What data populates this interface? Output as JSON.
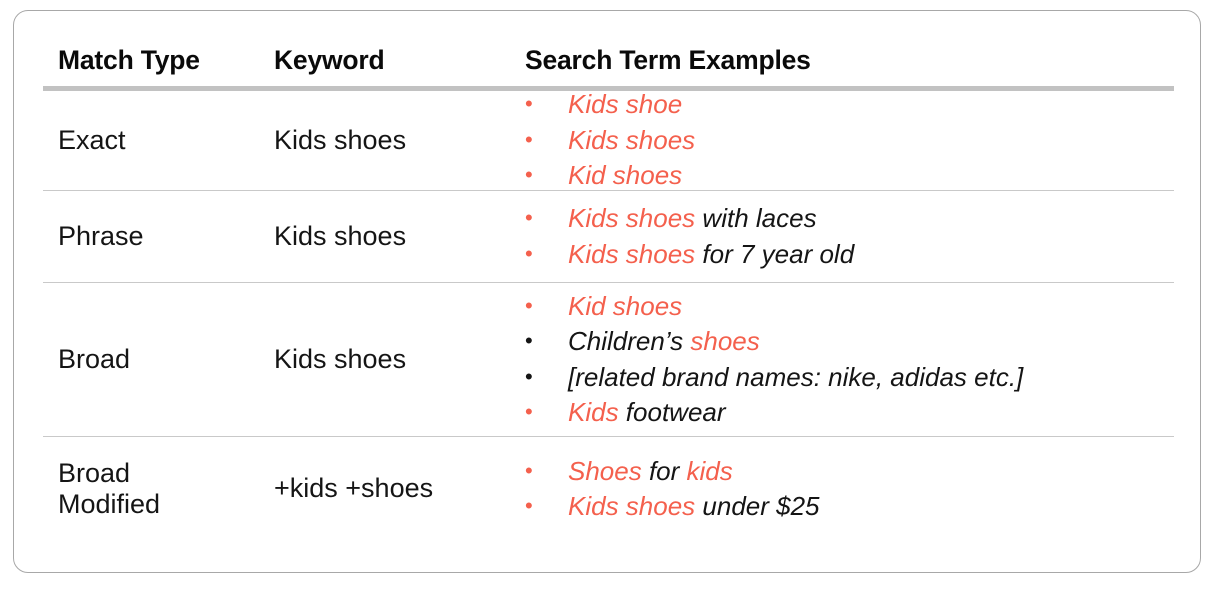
{
  "colors": {
    "highlight_red": "#f4604d",
    "text_black": "#151515",
    "header_bar_gray": "#c2c2c2",
    "divider_gray": "#c9c9c9",
    "card_border_gray": "#a8a8a8"
  },
  "table": {
    "headers": {
      "match_type": "Match Type",
      "keyword": "Keyword",
      "search_term_examples": "Search Term Examples"
    },
    "rows": [
      {
        "match_type": "Exact",
        "keyword": "Kids shoes",
        "examples": [
          {
            "bullet_color": "red",
            "segments": [
              {
                "text": "Kids shoe",
                "color": "red"
              }
            ]
          },
          {
            "bullet_color": "red",
            "segments": [
              {
                "text": "Kids shoes",
                "color": "red"
              }
            ]
          },
          {
            "bullet_color": "red",
            "segments": [
              {
                "text": "Kid shoes",
                "color": "red"
              }
            ]
          }
        ]
      },
      {
        "match_type": "Phrase",
        "keyword": "Kids shoes",
        "examples": [
          {
            "bullet_color": "red",
            "segments": [
              {
                "text": "Kids shoes",
                "color": "red"
              },
              {
                "text": " with laces",
                "color": "black"
              }
            ]
          },
          {
            "bullet_color": "red",
            "segments": [
              {
                "text": "Kids shoes",
                "color": "red"
              },
              {
                "text": " for 7 year old",
                "color": "black"
              }
            ]
          }
        ]
      },
      {
        "match_type": "Broad",
        "keyword": "Kids shoes",
        "examples": [
          {
            "bullet_color": "red",
            "segments": [
              {
                "text": "Kid shoes",
                "color": "red"
              }
            ]
          },
          {
            "bullet_color": "black",
            "segments": [
              {
                "text": "Children’s ",
                "color": "black"
              },
              {
                "text": "shoes",
                "color": "red"
              }
            ]
          },
          {
            "bullet_color": "black",
            "segments": [
              {
                "text": "[related brand names: nike, adidas etc.]",
                "color": "black"
              }
            ]
          },
          {
            "bullet_color": "red",
            "segments": [
              {
                "text": "Kids",
                "color": "red"
              },
              {
                "text": " footwear",
                "color": "black"
              }
            ]
          }
        ]
      },
      {
        "match_type": "Broad\nModified",
        "keyword": "+kids +shoes",
        "examples": [
          {
            "bullet_color": "red",
            "segments": [
              {
                "text": "Shoes",
                "color": "red"
              },
              {
                "text": " for ",
                "color": "black"
              },
              {
                "text": "kids",
                "color": "red"
              }
            ]
          },
          {
            "bullet_color": "red",
            "segments": [
              {
                "text": "Kids shoes",
                "color": "red"
              },
              {
                "text": " under $25",
                "color": "black"
              }
            ]
          }
        ]
      }
    ]
  }
}
